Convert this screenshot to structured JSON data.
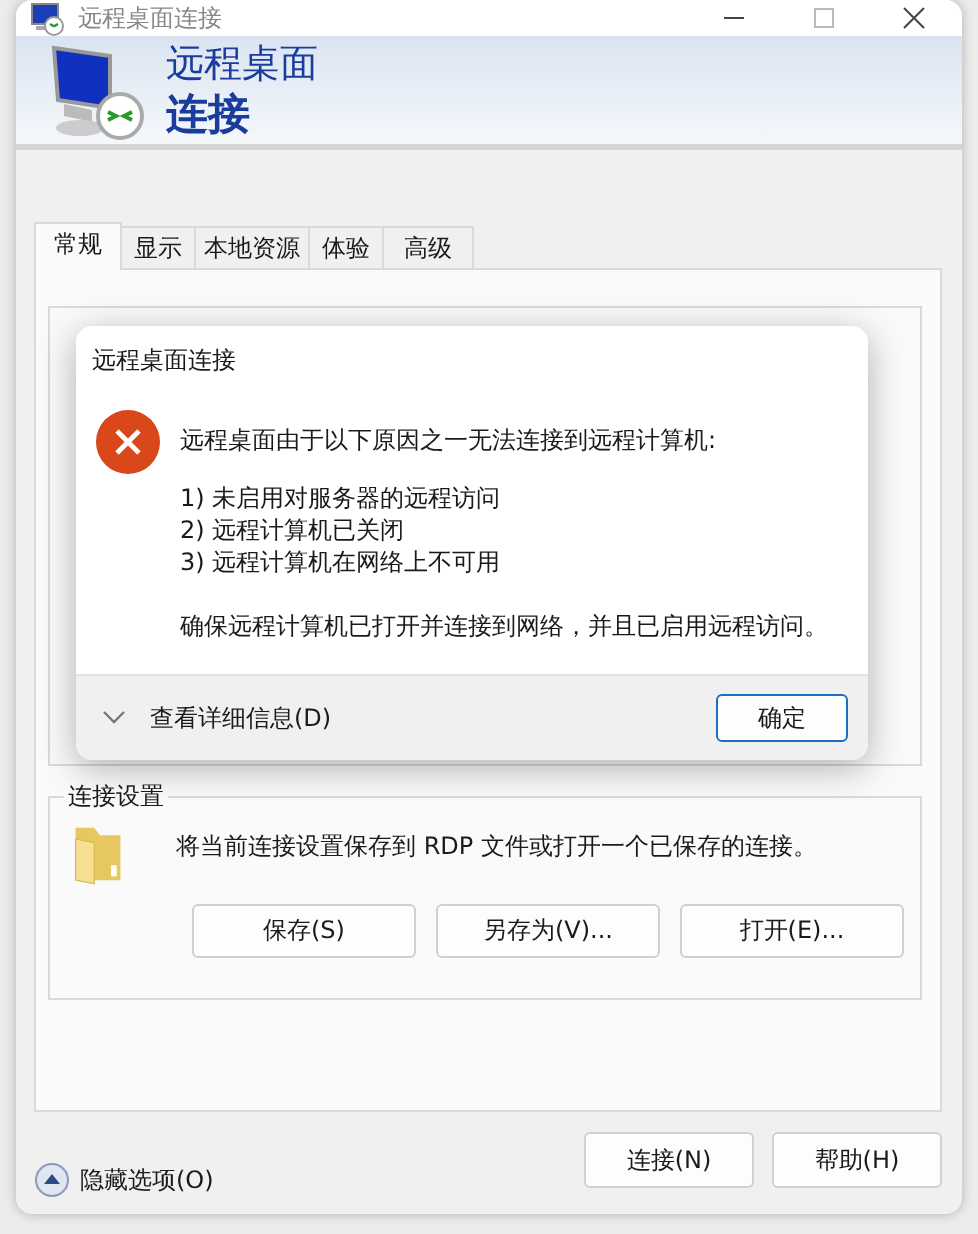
{
  "window": {
    "title": "远程桌面连接"
  },
  "banner": {
    "line1": "远程桌面",
    "line2": "连接"
  },
  "tabs": [
    {
      "label": "常规",
      "selected": true
    },
    {
      "label": "显示",
      "selected": false
    },
    {
      "label": "本地资源",
      "selected": false
    },
    {
      "label": "体验",
      "selected": false
    },
    {
      "label": "高级",
      "selected": false
    }
  ],
  "connection_settings": {
    "title": "连接设置",
    "description": "将当前连接设置保存到 RDP 文件或打开一个已保存的连接。",
    "buttons": [
      "保存(S)",
      "另存为(V)...",
      "打开(E)..."
    ]
  },
  "options_toggle": {
    "label": "隐藏选项(O)",
    "expanded": true
  },
  "buttons": [
    "连接(N)",
    "帮助(H)"
  ],
  "dialog": {
    "title": "远程桌面连接",
    "message": "远程桌面由于以下原因之一无法连接到远程计算机:",
    "reasons": [
      "1) 未启用对服务器的远程访问",
      "2) 远程计算机已关闭",
      "3) 远程计算机在网络上不可用"
    ],
    "advice": "确保远程计算机已打开并连接到网络，并且已启用远程访问。",
    "details_toggle": {
      "label": "查看详细信息(D)",
      "expanded": false
    },
    "buttons": [
      "确定"
    ]
  }
}
